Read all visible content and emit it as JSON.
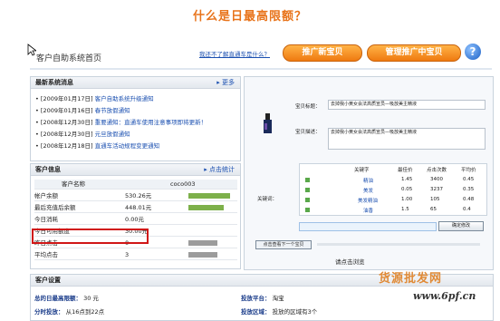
{
  "page_title": "什么是日最高限额？",
  "header": {
    "portal_title": "客户自助系统首页",
    "help_link": "我还不了解直通车是什么？",
    "btn_add": "推广新宝贝",
    "btn_manage": "管理推广中宝贝",
    "help_icon": "?"
  },
  "news": {
    "title": "最新系统消息",
    "more": "更多",
    "items": [
      {
        "date": "[2009年01月17日]",
        "text": "客户自助系统升级通知"
      },
      {
        "date": "[2009年01月16日]",
        "text": "春节放假通知"
      },
      {
        "date": "[2008年12月30日]",
        "text": "重要通知：直通车使用注意事项即将更新！"
      },
      {
        "date": "[2008年12月30日]",
        "text": "元旦放假通知"
      },
      {
        "date": "[2008年12月18日]",
        "text": "直通车活动规程变更通知"
      }
    ]
  },
  "customer": {
    "title": "客户信息",
    "stat_link": "点击统计",
    "name_label": "客户名称",
    "name_value": "coco003",
    "rows": [
      {
        "label": "帐户余额",
        "value": "530.26元",
        "bar": 0.85
      },
      {
        "label": "最后充值后余额",
        "value": "448.01元",
        "bar": 0.72
      },
      {
        "label": "今日消耗",
        "value": "0.00元",
        "bar": 0
      },
      {
        "label": "今日可用额度",
        "value": "30.00元",
        "bar": 0
      },
      {
        "label": "昨日点击",
        "value": "0",
        "bar": 0.6
      },
      {
        "label": "平均点击",
        "value": "3",
        "bar": 0.6
      }
    ]
  },
  "preview": {
    "title_label": "宝贝标题：",
    "title_value": "去掉我小黄女会法高质宣员—吸放美主精液",
    "desc_label": "宝贝描述：",
    "desc_value": "去掉我小黄女会法高质宣员—吸放美主精液",
    "keyword_label": "关键词：",
    "table_headers": [
      "关键字",
      "最佳价",
      "点击次数",
      "平均价"
    ],
    "table_rows": [
      [
        "精油",
        "1.45",
        "3400",
        "0.45"
      ],
      [
        "美发",
        "0.05",
        "3237",
        "0.35"
      ],
      [
        "美发精油",
        "1.00",
        "105",
        "0.48"
      ],
      [
        "油香",
        "1.5",
        "65",
        "0.4"
      ]
    ],
    "btn_save": "确定修改",
    "btn_bottom": "点击查看下一个宝贝",
    "bottom_text": "请点击浏览"
  },
  "settings": {
    "title": "客户设置",
    "limit_label": "总的日最高限额：",
    "limit_value": "30 元",
    "platform_label": "投放平台：",
    "platform_value": "淘宝",
    "time_label": "分时投放：",
    "time_value": "从16点到22点",
    "region_label": "投放区域：",
    "region_value": "投放的区域有3个"
  },
  "watermark": {
    "brand": "货源批发网",
    "url": "www.6pf.cn"
  }
}
